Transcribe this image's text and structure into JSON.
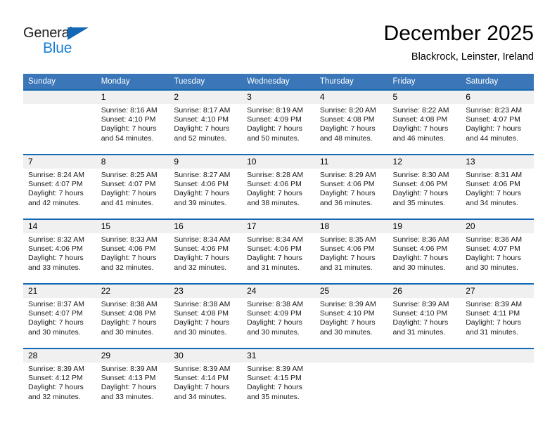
{
  "brand": {
    "name_part1": "General",
    "name_part2": "Blue",
    "accent_color": "#1268b3",
    "blue_text_color": "#1a7fd4"
  },
  "header": {
    "title": "December 2025",
    "subtitle": "Blackrock, Leinster, Ireland"
  },
  "calendar": {
    "header_bg": "#3a76b8",
    "separator_color": "#1268b3",
    "daynum_bg": "#f0f0f0",
    "weekdays": [
      "Sunday",
      "Monday",
      "Tuesday",
      "Wednesday",
      "Thursday",
      "Friday",
      "Saturday"
    ],
    "weeks": [
      [
        {
          "day": "",
          "lines": []
        },
        {
          "day": "1",
          "lines": [
            "Sunrise: 8:16 AM",
            "Sunset: 4:10 PM",
            "Daylight: 7 hours",
            "and 54 minutes."
          ]
        },
        {
          "day": "2",
          "lines": [
            "Sunrise: 8:17 AM",
            "Sunset: 4:10 PM",
            "Daylight: 7 hours",
            "and 52 minutes."
          ]
        },
        {
          "day": "3",
          "lines": [
            "Sunrise: 8:19 AM",
            "Sunset: 4:09 PM",
            "Daylight: 7 hours",
            "and 50 minutes."
          ]
        },
        {
          "day": "4",
          "lines": [
            "Sunrise: 8:20 AM",
            "Sunset: 4:08 PM",
            "Daylight: 7 hours",
            "and 48 minutes."
          ]
        },
        {
          "day": "5",
          "lines": [
            "Sunrise: 8:22 AM",
            "Sunset: 4:08 PM",
            "Daylight: 7 hours",
            "and 46 minutes."
          ]
        },
        {
          "day": "6",
          "lines": [
            "Sunrise: 8:23 AM",
            "Sunset: 4:07 PM",
            "Daylight: 7 hours",
            "and 44 minutes."
          ]
        }
      ],
      [
        {
          "day": "7",
          "lines": [
            "Sunrise: 8:24 AM",
            "Sunset: 4:07 PM",
            "Daylight: 7 hours",
            "and 42 minutes."
          ]
        },
        {
          "day": "8",
          "lines": [
            "Sunrise: 8:25 AM",
            "Sunset: 4:07 PM",
            "Daylight: 7 hours",
            "and 41 minutes."
          ]
        },
        {
          "day": "9",
          "lines": [
            "Sunrise: 8:27 AM",
            "Sunset: 4:06 PM",
            "Daylight: 7 hours",
            "and 39 minutes."
          ]
        },
        {
          "day": "10",
          "lines": [
            "Sunrise: 8:28 AM",
            "Sunset: 4:06 PM",
            "Daylight: 7 hours",
            "and 38 minutes."
          ]
        },
        {
          "day": "11",
          "lines": [
            "Sunrise: 8:29 AM",
            "Sunset: 4:06 PM",
            "Daylight: 7 hours",
            "and 36 minutes."
          ]
        },
        {
          "day": "12",
          "lines": [
            "Sunrise: 8:30 AM",
            "Sunset: 4:06 PM",
            "Daylight: 7 hours",
            "and 35 minutes."
          ]
        },
        {
          "day": "13",
          "lines": [
            "Sunrise: 8:31 AM",
            "Sunset: 4:06 PM",
            "Daylight: 7 hours",
            "and 34 minutes."
          ]
        }
      ],
      [
        {
          "day": "14",
          "lines": [
            "Sunrise: 8:32 AM",
            "Sunset: 4:06 PM",
            "Daylight: 7 hours",
            "and 33 minutes."
          ]
        },
        {
          "day": "15",
          "lines": [
            "Sunrise: 8:33 AM",
            "Sunset: 4:06 PM",
            "Daylight: 7 hours",
            "and 32 minutes."
          ]
        },
        {
          "day": "16",
          "lines": [
            "Sunrise: 8:34 AM",
            "Sunset: 4:06 PM",
            "Daylight: 7 hours",
            "and 32 minutes."
          ]
        },
        {
          "day": "17",
          "lines": [
            "Sunrise: 8:34 AM",
            "Sunset: 4:06 PM",
            "Daylight: 7 hours",
            "and 31 minutes."
          ]
        },
        {
          "day": "18",
          "lines": [
            "Sunrise: 8:35 AM",
            "Sunset: 4:06 PM",
            "Daylight: 7 hours",
            "and 31 minutes."
          ]
        },
        {
          "day": "19",
          "lines": [
            "Sunrise: 8:36 AM",
            "Sunset: 4:06 PM",
            "Daylight: 7 hours",
            "and 30 minutes."
          ]
        },
        {
          "day": "20",
          "lines": [
            "Sunrise: 8:36 AM",
            "Sunset: 4:07 PM",
            "Daylight: 7 hours",
            "and 30 minutes."
          ]
        }
      ],
      [
        {
          "day": "21",
          "lines": [
            "Sunrise: 8:37 AM",
            "Sunset: 4:07 PM",
            "Daylight: 7 hours",
            "and 30 minutes."
          ]
        },
        {
          "day": "22",
          "lines": [
            "Sunrise: 8:38 AM",
            "Sunset: 4:08 PM",
            "Daylight: 7 hours",
            "and 30 minutes."
          ]
        },
        {
          "day": "23",
          "lines": [
            "Sunrise: 8:38 AM",
            "Sunset: 4:08 PM",
            "Daylight: 7 hours",
            "and 30 minutes."
          ]
        },
        {
          "day": "24",
          "lines": [
            "Sunrise: 8:38 AM",
            "Sunset: 4:09 PM",
            "Daylight: 7 hours",
            "and 30 minutes."
          ]
        },
        {
          "day": "25",
          "lines": [
            "Sunrise: 8:39 AM",
            "Sunset: 4:10 PM",
            "Daylight: 7 hours",
            "and 30 minutes."
          ]
        },
        {
          "day": "26",
          "lines": [
            "Sunrise: 8:39 AM",
            "Sunset: 4:10 PM",
            "Daylight: 7 hours",
            "and 31 minutes."
          ]
        },
        {
          "day": "27",
          "lines": [
            "Sunrise: 8:39 AM",
            "Sunset: 4:11 PM",
            "Daylight: 7 hours",
            "and 31 minutes."
          ]
        }
      ],
      [
        {
          "day": "28",
          "lines": [
            "Sunrise: 8:39 AM",
            "Sunset: 4:12 PM",
            "Daylight: 7 hours",
            "and 32 minutes."
          ]
        },
        {
          "day": "29",
          "lines": [
            "Sunrise: 8:39 AM",
            "Sunset: 4:13 PM",
            "Daylight: 7 hours",
            "and 33 minutes."
          ]
        },
        {
          "day": "30",
          "lines": [
            "Sunrise: 8:39 AM",
            "Sunset: 4:14 PM",
            "Daylight: 7 hours",
            "and 34 minutes."
          ]
        },
        {
          "day": "31",
          "lines": [
            "Sunrise: 8:39 AM",
            "Sunset: 4:15 PM",
            "Daylight: 7 hours",
            "and 35 minutes."
          ]
        },
        {
          "day": "",
          "lines": []
        },
        {
          "day": "",
          "lines": []
        },
        {
          "day": "",
          "lines": []
        }
      ]
    ]
  }
}
